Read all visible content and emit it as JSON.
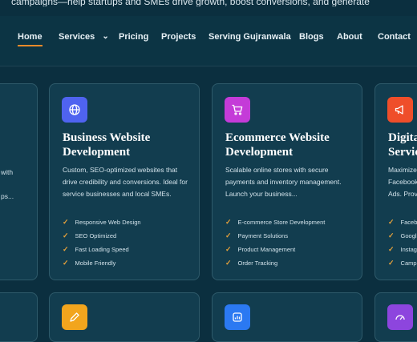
{
  "topline": "campaigns—help startups and SMEs drive growth, boost conversions, and generate",
  "nav": {
    "items": [
      {
        "label": "Home"
      },
      {
        "label": "Services"
      },
      {
        "label": "Pricing"
      },
      {
        "label": "Projects"
      },
      {
        "label": "Serving Gujranwala"
      },
      {
        "label": "Blogs"
      },
      {
        "label": "About"
      },
      {
        "label": "Contact"
      }
    ],
    "active": "Home",
    "services_chevron": "⌄"
  },
  "left_partial": {
    "line1": "with",
    "line2": "ps..."
  },
  "cards": [
    {
      "title_line1": "Business Website",
      "title_line2": "Development",
      "desc": "Custom, SEO-optimized websites that drive credibility and conversions. Ideal for service businesses and local SMEs.",
      "features": [
        "Responsive Web Design",
        "SEO Optimized",
        "Fast Loading Speed",
        "Mobile Friendly"
      ],
      "icon": "globe-icon",
      "icon_color": "#4f63f0"
    },
    {
      "title_line1": "Ecommerce Website",
      "title_line2": "Development",
      "desc": "Scalable online stores with secure payments and inventory management. Launch your business...",
      "features": [
        "E-commerce Store Development",
        "Payment Solutions",
        "Product Management",
        "Order Tracking"
      ],
      "icon": "cart-icon",
      "icon_color": "#c43bd8"
    },
    {
      "title_line1": "Digita",
      "title_line2": "Servic",
      "desc_lines": [
        "Maximize",
        "Facebook",
        "Ads. Prov"
      ],
      "features": [
        "Faceb",
        "Googl",
        "Instag",
        "Camp"
      ],
      "icon": "megaphone-icon",
      "icon_color": "#ef4e2a"
    }
  ],
  "bottom_icons": [
    {
      "icon": "pencil-icon",
      "color": "#f2a51d"
    },
    {
      "icon": "chart-icon",
      "color": "#2b79f2"
    },
    {
      "icon": "gauge-icon",
      "color": "#8d45de"
    }
  ],
  "accent": "#f08a2a",
  "tick_color": "#e7a23b"
}
